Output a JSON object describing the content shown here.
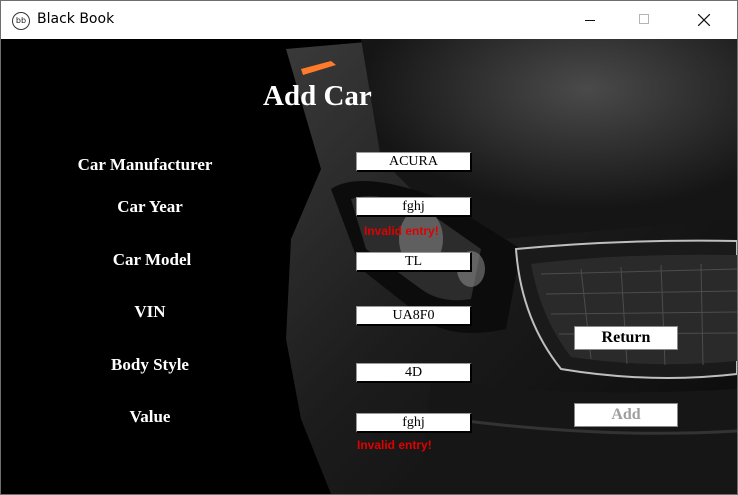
{
  "window": {
    "title": "Black Book",
    "icon_text": "bb"
  },
  "form": {
    "heading": "Add Car",
    "fields": [
      {
        "label": "Car Manufacturer",
        "value": "ACURA"
      },
      {
        "label": "Car Year",
        "value": "fghj",
        "error": "Invalid entry!"
      },
      {
        "label": "Car Model",
        "value": "TL"
      },
      {
        "label": "VIN",
        "value": "UA8F0"
      },
      {
        "label": "Body Style",
        "value": "4D"
      },
      {
        "label": "Value",
        "value": "fghj",
        "error": "Invalid entry!"
      }
    ]
  },
  "buttons": {
    "return_label": "Return",
    "add_label": "Add"
  },
  "colors": {
    "error": "#e00000",
    "background": "#000000"
  }
}
